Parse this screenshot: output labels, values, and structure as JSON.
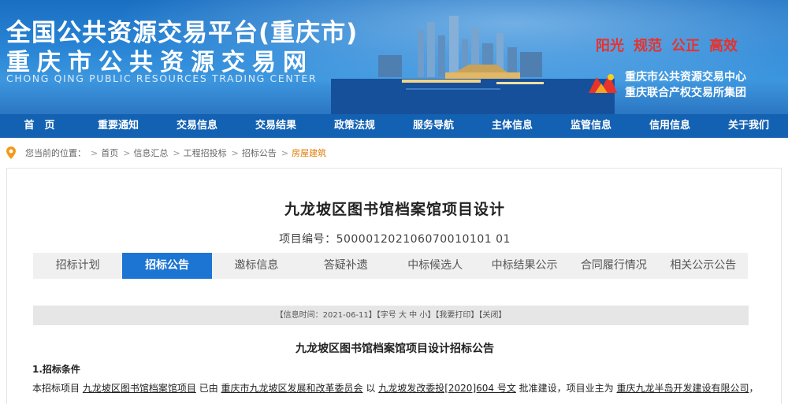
{
  "banner": {
    "title_line1": "全国公共资源交易平台(重庆市)",
    "title_line2": "重庆市公共资源交易网",
    "title_line3": "CHONG QING PUBLIC RESOURCES TRADING CENTER",
    "slogans": [
      "阳光",
      "规范",
      "公正",
      "高效"
    ],
    "org_line1": "重庆市公共资源交易中心",
    "org_line2": "重庆联合产权交易所集团",
    "slogan_color": "#e8322b"
  },
  "nav": {
    "items": [
      "首　页",
      "重要通知",
      "交易信息",
      "交易结果",
      "政策法规",
      "服务导航",
      "主体信息",
      "监管信息",
      "信用信息",
      "关于我们"
    ],
    "bg_color": "#1361b2"
  },
  "breadcrumb": {
    "icon": "location-pin-icon",
    "prefix": "您当前的位置：",
    "items": [
      "首页",
      "信息汇总",
      "工程招投标",
      "招标公告",
      "房屋建筑"
    ],
    "current_color": "#e07a00"
  },
  "project": {
    "title": "九龙坡区图书馆档案馆项目设计",
    "number": "项目编号：500001202106070010101 01"
  },
  "tabs": {
    "items": [
      "招标计划",
      "招标公告",
      "邀标信息",
      "答疑补遗",
      "中标候选人",
      "中标结果公示",
      "合同履行情况",
      "相关公示公告"
    ],
    "active_index": 1,
    "active_color": "#1c74d3"
  },
  "infobar": {
    "date": "【信息时间：2021-06-11】",
    "font_size_label": "【字号",
    "size_large": "大",
    "size_medium": "中",
    "size_small": "小",
    "close_bracket": "】",
    "print": "【我要打印】",
    "close": "【关闭】"
  },
  "notice": {
    "title": "九龙坡区图书馆档案馆项目设计招标公告",
    "section1_heading": "1.招标条件",
    "para_t1": "本招标项目",
    "para_project": "九龙坡区图书馆档案馆项目",
    "para_t2": "已由",
    "para_approver": "重庆市九龙坡区发展和改革委员会",
    "para_t3": "以",
    "para_doc": "九龙坡发改委投[2020]604 号文",
    "para_t4": "批准建设，项目业主为",
    "para_owner": "重庆九龙半岛开发建设有限公司",
    "para_t5": "，"
  }
}
